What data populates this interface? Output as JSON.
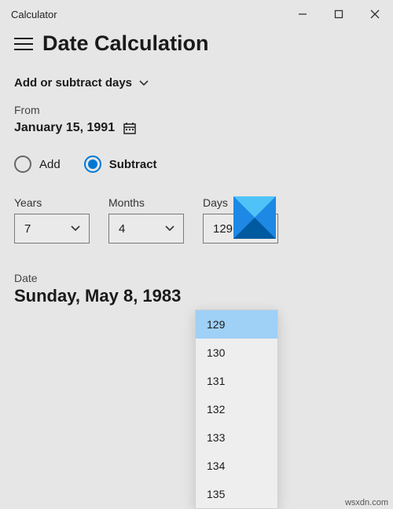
{
  "window": {
    "title": "Calculator"
  },
  "header": {
    "title": "Date Calculation"
  },
  "mode": {
    "label": "Add or subtract days"
  },
  "from": {
    "label": "From",
    "value": "January 15, 1991"
  },
  "operation": {
    "add_label": "Add",
    "subtract_label": "Subtract",
    "selected": "subtract"
  },
  "ymd": {
    "years": {
      "label": "Years",
      "value": "7"
    },
    "months": {
      "label": "Months",
      "value": "4"
    },
    "days": {
      "label": "Days",
      "value": "129"
    }
  },
  "days_dropdown": {
    "selected": "129",
    "options": [
      "129",
      "130",
      "131",
      "132",
      "133",
      "134",
      "135"
    ]
  },
  "result": {
    "label": "Date",
    "value": "Sunday, May 8, 1983"
  },
  "watermark": "wsxdn.com",
  "colors": {
    "accent": "#0078d4",
    "bg": "#e6e6e6",
    "logo_dark": "#005aa0",
    "logo_light": "#4fc3f7"
  }
}
